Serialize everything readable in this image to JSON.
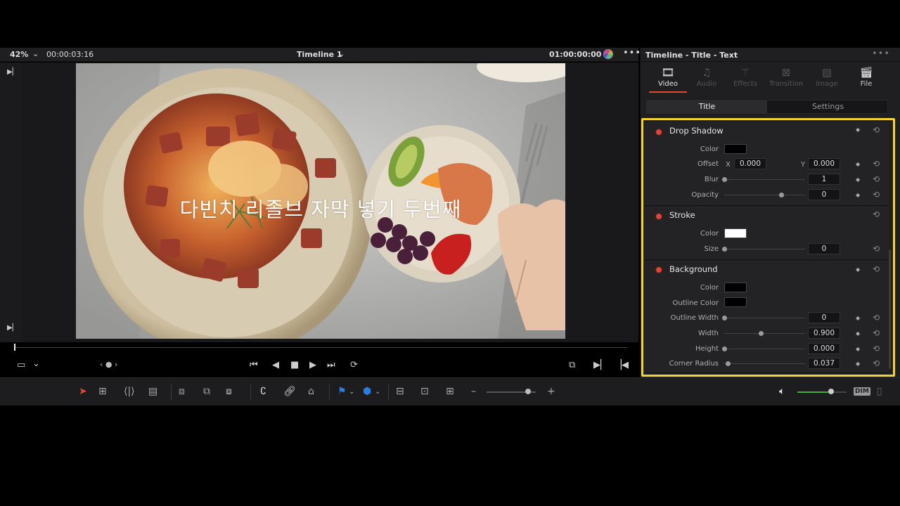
{
  "viewer": {
    "zoom": "42%",
    "timecode_left": "00:00:03:16",
    "timeline_name": "Timeline 1",
    "timecode_right": "01:00:00:00",
    "subtitle_text": "다빈치 리졸브 자막 넣기 두번째"
  },
  "inspector": {
    "title": "Timeline - Title - Text",
    "tabs": [
      {
        "label": "Video",
        "icon": "film-icon",
        "active": true
      },
      {
        "label": "Audio",
        "icon": "music-icon",
        "active": false
      },
      {
        "label": "Effects",
        "icon": "wand-icon",
        "active": false
      },
      {
        "label": "Transition",
        "icon": "transition-icon",
        "active": false
      },
      {
        "label": "Image",
        "icon": "image-icon",
        "active": false
      },
      {
        "label": "File",
        "icon": "file-icon",
        "active": false
      }
    ],
    "subtabs": [
      "Title",
      "Settings"
    ],
    "drop_shadow": {
      "label": "Drop Shadow",
      "color_label": "Color",
      "color": "#000000",
      "offset_label": "Offset",
      "x_label": "X",
      "offset_x": "0.000",
      "y_label": "Y",
      "offset_y": "0.000",
      "blur_label": "Blur",
      "blur": "1",
      "opacity_label": "Opacity",
      "opacity": "0",
      "opacity_level": 0.7
    },
    "stroke": {
      "label": "Stroke",
      "color_label": "Color",
      "color": "#ffffff",
      "size_label": "Size",
      "size": "0"
    },
    "background": {
      "label": "Background",
      "color_label": "Color",
      "color": "#000000",
      "outline_color_label": "Outline Color",
      "outline_color": "#000000",
      "outline_width_label": "Outline Width",
      "outline_width": "0",
      "width_label": "Width",
      "width": "0.900",
      "width_level": 0.45,
      "height_label": "Height",
      "height": "0.000",
      "corner_radius_label": "Corner Radius",
      "corner_radius": "0.037"
    }
  },
  "colors": {
    "accent": "#e24a2d",
    "highlight": "#f2d335",
    "enable_dot": "#e0443a",
    "flag_blue": "#2a7de1",
    "volume_green": "#3fae3f"
  }
}
